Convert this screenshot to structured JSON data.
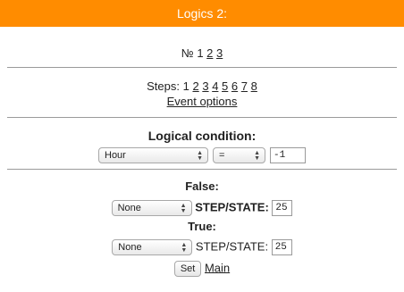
{
  "header": {
    "title": "Logics 2:"
  },
  "number_nav": {
    "prefix": "№",
    "current": "1",
    "links": [
      "2",
      "3"
    ]
  },
  "steps_nav": {
    "label": "Steps:",
    "current": "1",
    "links": [
      "2",
      "3",
      "4",
      "5",
      "6",
      "7",
      "8"
    ]
  },
  "event_options": {
    "label": "Event options"
  },
  "condition": {
    "title": "Logical condition:",
    "variable": "Hour",
    "operator": "=",
    "value": "-1"
  },
  "false_branch": {
    "title": "False:",
    "action": "None",
    "step_label": "STEP/STATE:",
    "step_value": "25"
  },
  "true_branch": {
    "title": "True:",
    "action": "None",
    "step_label": "STEP/STATE:",
    "step_value": "25"
  },
  "actions": {
    "set_label": "Set",
    "main_label": "Main"
  },
  "colors": {
    "header_bg": "#ff8c00",
    "header_text": "#ffffff",
    "divider": "#9a9a9a"
  },
  "icons": {
    "select_arrow": "up-down-arrows-icon"
  }
}
